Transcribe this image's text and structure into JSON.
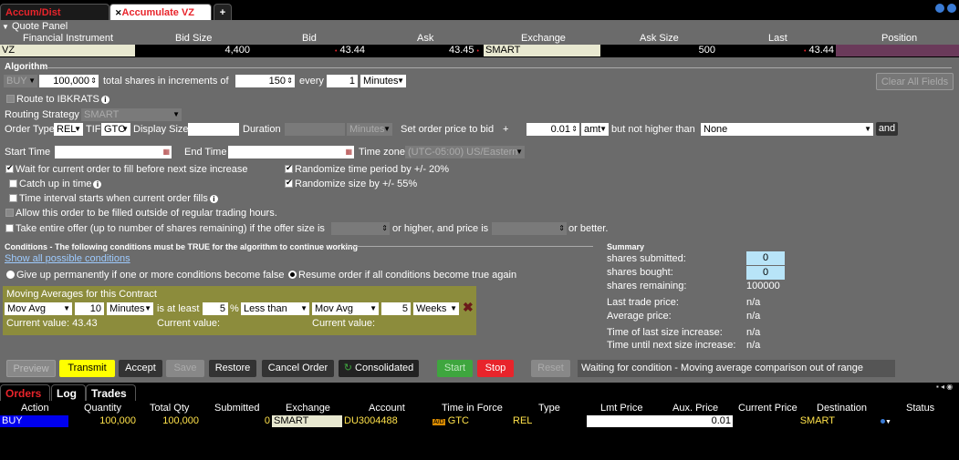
{
  "tabs": [
    {
      "label": "Accum/Dist Summary",
      "active": false
    },
    {
      "label": "Accumulate VZ",
      "active": true
    }
  ],
  "add_tab": "+",
  "quote_panel": {
    "title": "Quote Panel",
    "headers": [
      "Financial Instrument",
      "Bid Size",
      "Bid",
      "Ask",
      "Exchange",
      "Ask Size",
      "Last",
      "Position"
    ],
    "row": {
      "instrument": "VZ",
      "bid_size": "4,400",
      "bid": "43.44",
      "ask": "43.45",
      "exchange": "SMART",
      "ask_size": "500",
      "last": "43.44",
      "position": ""
    }
  },
  "algorithm": {
    "title": "Algorithm",
    "side": "BUY",
    "total_shares": "100,000",
    "total_shares_label": "total shares in increments of",
    "increment": "150",
    "every_label": "every",
    "every_value": "1",
    "every_unit": "Minutes",
    "clear_all": "Clear All Fields",
    "route_label": "Route to IBKRATS",
    "routing_strategy_label": "Routing Strategy",
    "routing_strategy": "SMART",
    "order_type_label": "Order Type",
    "order_type": "REL",
    "tif_label": "TIF",
    "tif": "GTC",
    "display_size_label": "Display Size",
    "duration_label": "Duration",
    "duration_unit": "Minutes",
    "set_price_label": "Set order price to bid",
    "plus": "+",
    "offset": "0.01",
    "offset_unit": "amt",
    "not_higher_label": "but not higher than",
    "not_higher_value": "None",
    "and_button": "and",
    "start_time_label": "Start Time",
    "end_time_label": "End Time",
    "time_zone_label": "Time zone",
    "time_zone": "(UTC-05:00) US/Eastern",
    "wait_label": "Wait for current order to fill before next size increase",
    "catch_up_label": "Catch up in time",
    "interval_label": "Time interval starts when current order fills",
    "randomize_time_label": "Randomize time period by +/- 20%",
    "randomize_size_label": "Randomize size by +/- 55%",
    "outside_hours_label": "Allow this order to be filled outside of regular trading hours.",
    "take_offer_label": "Take entire offer (up to number of shares remaining) if the offer size is",
    "higher_price_label": "or higher, and price is",
    "or_better_label": "or better."
  },
  "conditions": {
    "title": "Conditions - The following conditions must be TRUE for the algorithm to continue working",
    "show_all": "Show all possible conditions",
    "give_up_label": "Give up permanently if one or more conditions become false",
    "resume_label": "Resume order if all conditions become true again",
    "box_title": "Moving Averages for this Contract",
    "ma1": "Mov Avg",
    "ma1_period": "10",
    "ma1_unit": "Minutes",
    "at_least_label": "is at least",
    "pct": "5",
    "pct_sign": "%",
    "compare": "Less than",
    "ma2": "Mov Avg",
    "ma2_period": "5",
    "ma2_unit": "Weeks",
    "current_value_label1": "Current value: 43.43",
    "current_value_label2": "Current value:",
    "current_value_label3": "Current value:"
  },
  "summary": {
    "title": "Summary",
    "shares_submitted_label": "shares submitted:",
    "shares_submitted": "0",
    "shares_bought_label": "shares bought:",
    "shares_bought": "0",
    "shares_remaining_label": "shares remaining:",
    "shares_remaining": "100000",
    "last_trade_label": "Last trade price:",
    "last_trade": "n/a",
    "avg_price_label": "Average price:",
    "avg_price": "n/a",
    "time_last_label": "Time of last size increase:",
    "time_last": "n/a",
    "time_next_label": "Time until next size increase:",
    "time_next": "n/a"
  },
  "buttons": {
    "preview": "Preview",
    "transmit": "Transmit",
    "accept": "Accept",
    "save": "Save",
    "restore": "Restore",
    "cancel_order": "Cancel Order",
    "consolidated": "Consolidated",
    "start": "Start",
    "stop": "Stop",
    "reset": "Reset",
    "status_message": "Waiting for condition - Moving average comparison out of range"
  },
  "bottom_tabs": [
    "Orders",
    "Log",
    "Trades"
  ],
  "orders": {
    "headers": [
      "Action",
      "Quantity",
      "Total Qty",
      "Submitted",
      "Exchange",
      "Account",
      "Time in Force",
      "Type",
      "Lmt Price",
      "Aux. Price",
      "Current Price",
      "Destination",
      "Status"
    ],
    "row": {
      "action": "BUY",
      "quantity": "100,000",
      "total_qty": "100,000",
      "submitted": "0",
      "exchange": "SMART",
      "account": "DU3004488",
      "tif_badge": "A/D",
      "tif": "GTC",
      "type": "REL",
      "lmt_price": "",
      "aux_price": "0.01",
      "current_price": "",
      "destination": "SMART",
      "status": ""
    }
  },
  "colors": {
    "active_tab": "#e8242b",
    "panel": "#6b6b6b",
    "transmit": "#ffff00",
    "start": "#3ea63e",
    "stop": "#e8242b",
    "conditions_box": "#8c8c3c",
    "buy_blue": "#0000ee"
  }
}
